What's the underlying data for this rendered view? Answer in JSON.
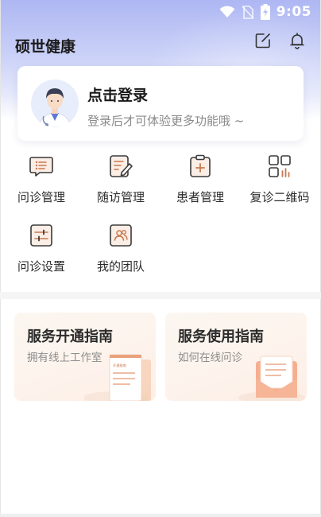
{
  "status": {
    "time": "9:05"
  },
  "app": {
    "title": "硕世健康"
  },
  "login": {
    "title": "点击登录",
    "subtitle": "登录后才可体验更多功能哦 ~"
  },
  "functions": [
    {
      "label": "问诊管理",
      "icon": "chat-list-icon"
    },
    {
      "label": "随访管理",
      "icon": "note-edit-icon"
    },
    {
      "label": "患者管理",
      "icon": "clipboard-plus-icon"
    },
    {
      "label": "复诊二维码",
      "icon": "qrcode-icon"
    },
    {
      "label": "问诊设置",
      "icon": "sliders-icon"
    },
    {
      "label": "我的团队",
      "icon": "team-icon"
    }
  ],
  "guides": [
    {
      "title": "服务开通指南",
      "subtitle": "拥有线上工作室",
      "badge": "开通指南"
    },
    {
      "title": "服务使用指南",
      "subtitle": "如何在线问诊"
    }
  ],
  "colors": {
    "icon_accent": "#c8794f",
    "header_gradient_top": "#aeb7f3"
  }
}
